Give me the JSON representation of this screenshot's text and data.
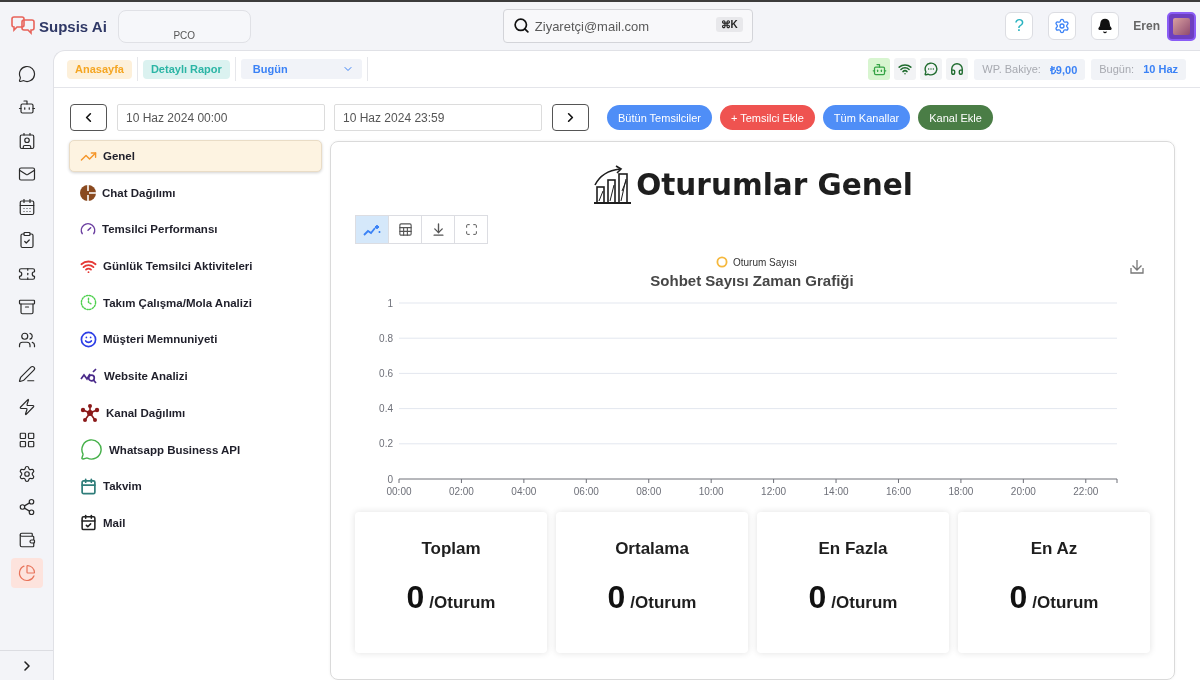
{
  "topbar": {
    "brand": "Supsis Ai",
    "workspace": "PCO",
    "search": {
      "value": "Ziyaretçi@mail.com",
      "shortcut": "⌘K"
    },
    "help_label": "?",
    "user_name": "Eren"
  },
  "sidebar": {
    "items": [
      {
        "selected": false
      },
      {
        "selected": false
      },
      {
        "selected": false
      },
      {
        "selected": false
      },
      {
        "selected": false
      },
      {
        "selected": false
      },
      {
        "selected": false
      },
      {
        "selected": false
      },
      {
        "selected": false
      },
      {
        "selected": false
      },
      {
        "selected": false
      },
      {
        "selected": false
      },
      {
        "selected": false
      },
      {
        "selected": false
      },
      {
        "selected": false
      },
      {
        "selected": true
      }
    ]
  },
  "subbar": {
    "tags": [
      {
        "label": "Anasayfa",
        "color": "#f5a623"
      },
      {
        "label": "Detaylı Rapor",
        "color": "#2bb5a5"
      }
    ],
    "period_select": "Bugün",
    "status_icons": [
      {
        "selected": true
      },
      {
        "selected": false
      },
      {
        "selected": false
      },
      {
        "selected": false
      }
    ],
    "balance": {
      "label": "WP. Bakiye:",
      "value": "₺9,00"
    },
    "today": {
      "label": "Bugün:",
      "value": "10 Haz"
    }
  },
  "date_range": {
    "start": "10 Haz 2024 00:00",
    "end": "10 Haz 2024 23:59"
  },
  "filter_buttons": [
    {
      "label": "Bütün Temsilciler",
      "color": "#4f8ef7"
    },
    {
      "label": "+ Temsilci Ekle",
      "color": "#ef5350"
    },
    {
      "label": "Tüm Kanallar",
      "color": "#4f8ef7"
    },
    {
      "label": "Kanal Ekle",
      "color": "#4a7d46"
    }
  ],
  "report_menu": [
    {
      "label": "Genel",
      "selected": true
    },
    {
      "label": "Chat Dağılımı",
      "selected": false
    },
    {
      "label": "Temsilci Performansı",
      "selected": false
    },
    {
      "label": "Günlük Temsilci Aktiviteleri",
      "selected": false
    },
    {
      "label": "Takım Çalışma/Mola Analizi",
      "selected": false
    },
    {
      "label": "Müşteri Memnuniyeti",
      "selected": false
    },
    {
      "label": "Website Analizi",
      "selected": false
    },
    {
      "label": "Kanal Dağılımı",
      "selected": false
    },
    {
      "label": "Whatsapp Business API",
      "selected": false
    },
    {
      "label": "Takvim",
      "selected": false
    },
    {
      "label": "Mail",
      "selected": false
    }
  ],
  "panel": {
    "title": "Oturumlar Genel",
    "toolbar": [
      {
        "selected": true
      },
      {
        "selected": false
      },
      {
        "selected": false
      },
      {
        "selected": false
      }
    ],
    "chart_data": {
      "type": "line",
      "title": "Sohbet Sayısı Zaman Grafiği",
      "categories": [
        "00:00",
        "02:00",
        "04:00",
        "06:00",
        "08:00",
        "10:00",
        "12:00",
        "14:00",
        "16:00",
        "18:00",
        "20:00",
        "22:00"
      ],
      "ylim": [
        0,
        1
      ],
      "yticks": [
        0,
        0.2,
        0.4,
        0.6,
        0.8,
        1
      ],
      "grid": true,
      "series": [
        {
          "name": "Oturum Sayısı",
          "color": "#f5b83d",
          "values": [
            null,
            null,
            null,
            null,
            null,
            null,
            null,
            null,
            null,
            null,
            null,
            null
          ]
        }
      ]
    }
  },
  "stats": [
    {
      "title": "Toplam",
      "value": "0",
      "unit": "/Oturum"
    },
    {
      "title": "Ortalama",
      "value": "0",
      "unit": "/Oturum"
    },
    {
      "title": "En Fazla",
      "value": "0",
      "unit": "/Oturum"
    },
    {
      "title": "En Az",
      "value": "0",
      "unit": "/Oturum"
    }
  ]
}
